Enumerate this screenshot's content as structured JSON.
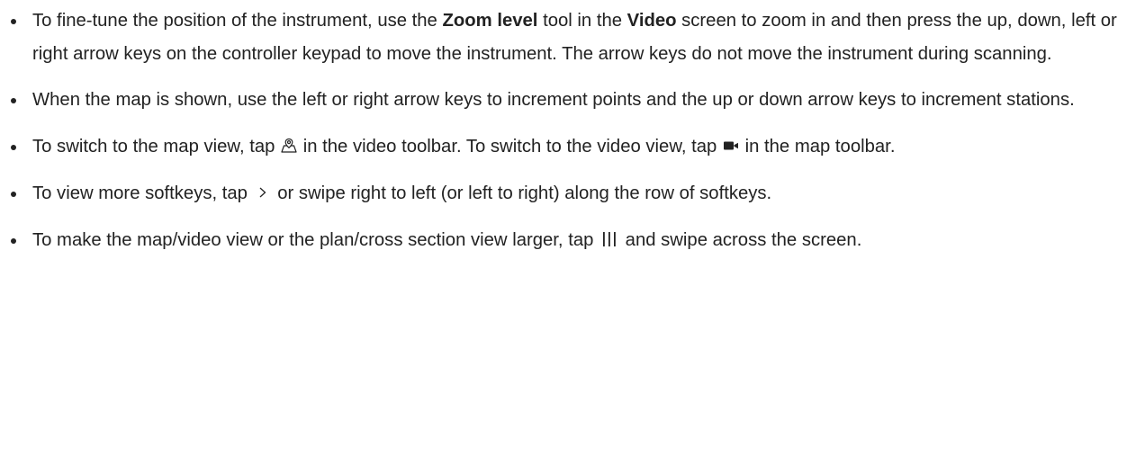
{
  "items": [
    {
      "parts": {
        "t1": "To fine-tune the position of the instrument, use the ",
        "b1": "Zoom level",
        "t2": " tool in the ",
        "b2": "Video",
        "t3": " screen to zoom in and then press the up, down, left or right arrow keys on the controller keypad to move the instrument. The arrow keys do not move the instrument during scanning."
      }
    },
    {
      "parts": {
        "t1": "When the map is shown, use the left or right arrow keys to increment points and the up or down arrow keys to increment stations."
      }
    },
    {
      "parts": {
        "t1": "To switch to the map view, tap ",
        "icon1": "map-icon",
        "t2": " in the video toolbar. To switch to the video view, tap ",
        "icon2": "video-camera-icon",
        "t3": " in the map toolbar."
      }
    },
    {
      "parts": {
        "t1": "To view more softkeys, tap ",
        "icon1": "chevron-right-icon",
        "t2": " or swipe right to left (or left to right) along the row of softkeys."
      }
    },
    {
      "parts": {
        "t1": "To make the map/video view or the plan/cross section view larger, tap ",
        "icon1": "resize-handle-icon",
        "t2": " and swipe across the screen."
      }
    }
  ]
}
